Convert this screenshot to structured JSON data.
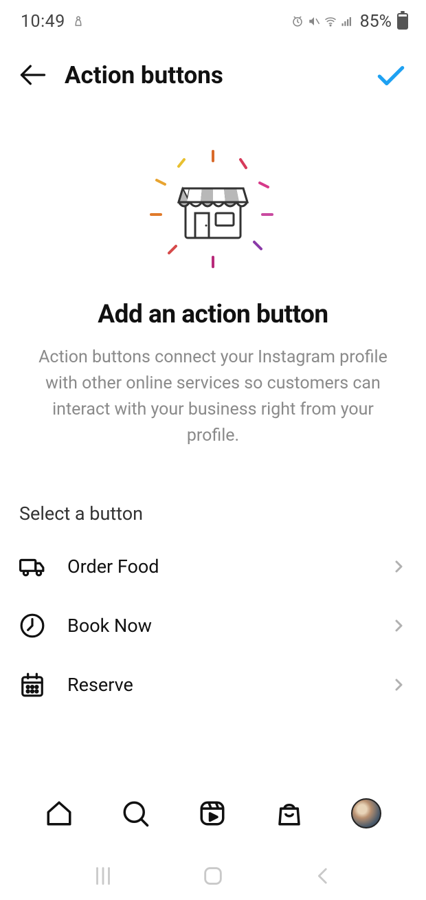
{
  "status": {
    "time": "10:49",
    "battery_pct": "85%"
  },
  "header": {
    "title": "Action buttons"
  },
  "hero": {
    "title": "Add an action button",
    "description": "Action buttons connect your Instagram profile with other online services so customers can interact with your business right from your profile."
  },
  "section": {
    "label": "Select a button",
    "options": [
      {
        "label": "Order Food",
        "icon": "truck-icon"
      },
      {
        "label": "Book Now",
        "icon": "clock-icon"
      },
      {
        "label": "Reserve",
        "icon": "calendar-icon"
      }
    ]
  }
}
